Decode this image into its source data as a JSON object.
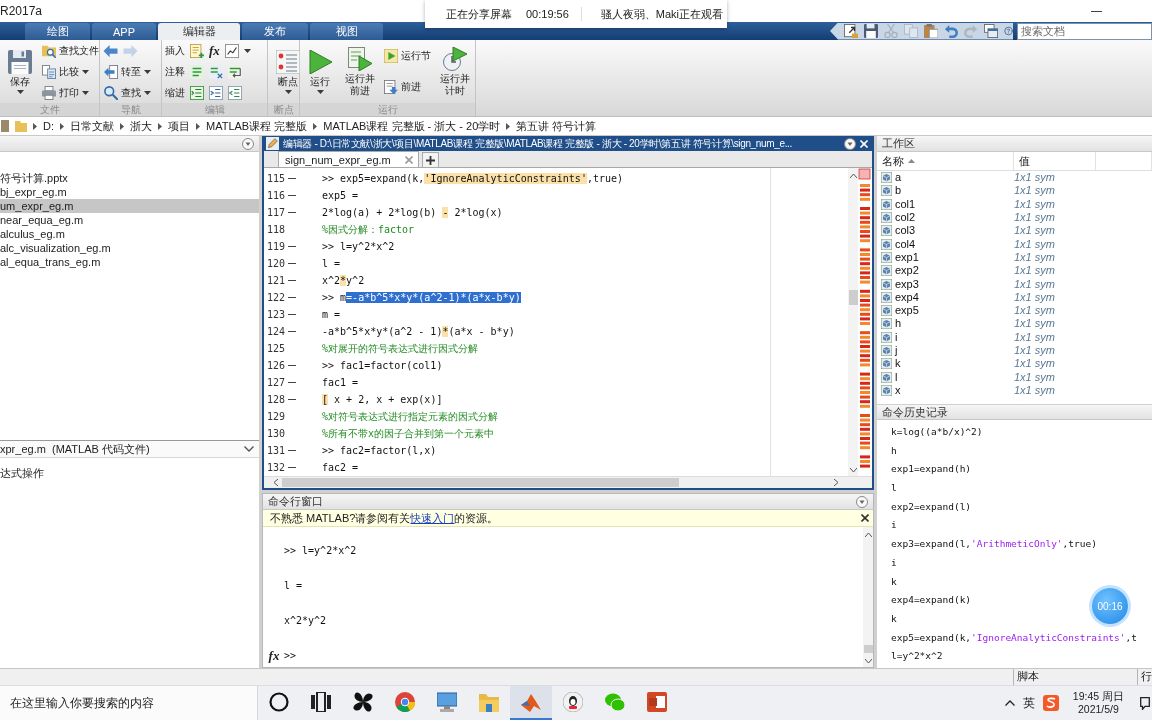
{
  "window": {
    "title": "R2017a"
  },
  "share_bar": {
    "status": "正在分享屏幕",
    "elapsed": "00:19:56",
    "viewers": "骚人夜弱、Maki正在观看"
  },
  "tabs": [
    {
      "label": "绘图",
      "selected": false
    },
    {
      "label": "APP",
      "selected": false
    },
    {
      "label": "编辑器",
      "selected": true
    },
    {
      "label": "发布",
      "selected": false
    },
    {
      "label": "视图",
      "selected": false
    }
  ],
  "quick_access": [
    {
      "disabled": false
    },
    {
      "disabled": false
    },
    {
      "disabled": true
    },
    {
      "disabled": true
    },
    {
      "disabled": false
    },
    {
      "disabled": false
    },
    {
      "disabled": true
    },
    {
      "disabled": false
    },
    {
      "disabled": false
    }
  ],
  "search": {
    "placeholder": "搜索文档"
  },
  "ribbon": [
    {
      "label": "文件",
      "columns": [
        [
          {
            "kind": "large",
            "label": "保存",
            "dropdown": true
          }
        ],
        [
          {
            "kind": "small",
            "label": "查找文件",
            "dropdown": false
          },
          {
            "kind": "small",
            "label": "比较",
            "dropdown": true
          },
          {
            "kind": "small",
            "label": "打印",
            "dropdown": true
          }
        ]
      ]
    },
    {
      "label": "导航",
      "columns": [
        [
          {
            "kind": "arrows",
            "forward_enabled": false
          },
          {
            "kind": "small",
            "label": "转至",
            "dropdown": true
          },
          {
            "kind": "small",
            "label": "查找",
            "dropdown": true
          }
        ]
      ]
    },
    {
      "label": "编辑",
      "columns": [
        [
          {
            "kind": "tools",
            "label": "插入",
            "symbol": "fx",
            "dropdown": true
          },
          {
            "kind": "tools",
            "label": "注释",
            "dropdown": false
          },
          {
            "kind": "tools",
            "label": "缩进",
            "dropdown": false
          }
        ]
      ]
    },
    {
      "label": "断点",
      "columns": [
        [
          {
            "kind": "large",
            "label": "断点",
            "dropdown": true
          }
        ]
      ]
    },
    {
      "label": "运行",
      "columns": [
        [
          {
            "kind": "large",
            "label": "运行",
            "dropdown": true
          }
        ],
        [
          {
            "kind": "large",
            "label": "运行并前进",
            "dropdown": false
          }
        ],
        [
          {
            "kind": "small",
            "label": "运行节",
            "dropdown": false
          },
          {
            "kind": "small",
            "label": "前进",
            "dropdown": false
          }
        ],
        [
          {
            "kind": "large",
            "label": "运行并计时",
            "dropdown": false
          }
        ]
      ]
    }
  ],
  "address_bar": {
    "segments": [
      "D:",
      "日常文献",
      "浙大",
      "项目",
      "MATLAB课程 完整版",
      "MATLAB课程 完整版 - 浙大 - 20学时",
      "第五讲 符号计算"
    ]
  },
  "current_folder": {
    "files": [
      {
        "name": "符号计算.pptx",
        "selected": false
      },
      {
        "name": "bj_expr_eg.m",
        "selected": false
      },
      {
        "name": "um_expr_eg.m",
        "selected": true
      },
      {
        "name": "near_equa_eg.m",
        "selected": false
      },
      {
        "name": "alculus_eg.m",
        "selected": false
      },
      {
        "name": "alc_visualization_eg.m",
        "selected": false
      },
      {
        "name": "al_equa_trans_eg.m",
        "selected": false
      }
    ],
    "details": {
      "title": "xpr_eg.m  (MATLAB 代码文件)",
      "description": "达式操作"
    }
  },
  "editor": {
    "title": "编辑器 - D:\\日常文献\\浙大\\项目\\MATLAB课程 完整版\\MATLAB课程 完整版 - 浙大 - 20学时\\第五讲 符号计算\\sign_num_e...",
    "tabs": [
      {
        "label": "sign_num_expr_eg.m",
        "selected": true
      }
    ],
    "lines": [
      {
        "number": "115",
        "executable": true,
        "parts": [
          {
            "kind": "code",
            "text": ">> exp5=expand(k,"
          },
          {
            "kind": "highlight",
            "text": "'IgnoreAnalyticConstraints'"
          },
          {
            "kind": "code",
            "text": ",true)"
          }
        ]
      },
      {
        "number": "116",
        "executable": true,
        "parts": [
          {
            "kind": "code",
            "text": "exp5 ="
          }
        ]
      },
      {
        "number": "117",
        "executable": true,
        "parts": [
          {
            "kind": "code",
            "text": "2*log(a) + 2*log(b) "
          },
          {
            "kind": "highlight",
            "text": "-"
          },
          {
            "kind": "code",
            "text": " 2*log(x)"
          }
        ]
      },
      {
        "number": "118",
        "executable": false,
        "parts": [
          {
            "kind": "comment",
            "text": "%因式分解：factor"
          }
        ]
      },
      {
        "number": "119",
        "executable": true,
        "parts": [
          {
            "kind": "code",
            "text": ">> l=y^2*x^2"
          }
        ]
      },
      {
        "number": "120",
        "executable": true,
        "parts": [
          {
            "kind": "code",
            "text": "l ="
          }
        ]
      },
      {
        "number": "121",
        "executable": true,
        "parts": [
          {
            "kind": "code",
            "text": "x^2"
          },
          {
            "kind": "highlight",
            "text": "*"
          },
          {
            "kind": "code",
            "text": "y^2"
          }
        ]
      },
      {
        "number": "122",
        "executable": true,
        "parts": [
          {
            "kind": "code",
            "text": ">> m"
          },
          {
            "kind": "selected",
            "text": "=-a*b^5*x*y*(a^2-1)*(a*x-b*y)"
          }
        ]
      },
      {
        "number": "123",
        "executable": true,
        "parts": [
          {
            "kind": "code",
            "text": "m ="
          }
        ]
      },
      {
        "number": "124",
        "executable": true,
        "parts": [
          {
            "kind": "code",
            "text": "-a*b^5*x*y*(a^2 - 1)"
          },
          {
            "kind": "highlight",
            "text": "*"
          },
          {
            "kind": "code",
            "text": "(a*x - b*y)"
          }
        ]
      },
      {
        "number": "125",
        "executable": false,
        "parts": [
          {
            "kind": "comment",
            "text": "%对展开的符号表达式进行因式分解"
          }
        ]
      },
      {
        "number": "126",
        "executable": true,
        "parts": [
          {
            "kind": "code",
            "text": ">> fac1=factor(col1)"
          }
        ]
      },
      {
        "number": "127",
        "executable": true,
        "parts": [
          {
            "kind": "code",
            "text": "fac1 ="
          }
        ]
      },
      {
        "number": "128",
        "executable": true,
        "parts": [
          {
            "kind": "highlight",
            "text": "["
          },
          {
            "kind": "code",
            "text": " x + 2, x + exp(x)]"
          }
        ]
      },
      {
        "number": "129",
        "executable": false,
        "parts": [
          {
            "kind": "comment",
            "text": "%对符号表达式进行指定元素的因式分解"
          }
        ]
      },
      {
        "number": "130",
        "executable": false,
        "parts": [
          {
            "kind": "comment",
            "text": "%所有不带x的因子合并到第一个元素中"
          }
        ]
      },
      {
        "number": "131",
        "executable": true,
        "parts": [
          {
            "kind": "code",
            "text": ">> fac2=factor(l,x)"
          }
        ]
      },
      {
        "number": "132",
        "executable": true,
        "parts": [
          {
            "kind": "code",
            "text": "fac2 ="
          }
        ]
      }
    ]
  },
  "command_window": {
    "title": "命令行窗口",
    "notice": {
      "before": "不熟悉 MATLAB?请参阅有关",
      "link": "快速入门",
      "after": "的资源。"
    },
    "lines": [
      ">> l=y^2*x^2",
      "l =",
      "x^2*y^2"
    ],
    "function_glyph": "fx",
    "prompt": ">>"
  },
  "workspace": {
    "title": "工作区",
    "columns": [
      {
        "label": "名称",
        "sorted": true
      },
      {
        "label": "值",
        "sorted": false
      }
    ],
    "variables": [
      {
        "name": "a",
        "value": "1x1 sym"
      },
      {
        "name": "b",
        "value": "1x1 sym"
      },
      {
        "name": "col1",
        "value": "1x1 sym"
      },
      {
        "name": "col2",
        "value": "1x1 sym"
      },
      {
        "name": "col3",
        "value": "1x1 sym"
      },
      {
        "name": "col4",
        "value": "1x1 sym"
      },
      {
        "name": "exp1",
        "value": "1x1 sym"
      },
      {
        "name": "exp2",
        "value": "1x1 sym"
      },
      {
        "name": "exp3",
        "value": "1x1 sym"
      },
      {
        "name": "exp4",
        "value": "1x1 sym"
      },
      {
        "name": "exp5",
        "value": "1x1 sym"
      },
      {
        "name": "h",
        "value": "1x1 sym"
      },
      {
        "name": "i",
        "value": "1x1 sym"
      },
      {
        "name": "j",
        "value": "1x1 sym"
      },
      {
        "name": "k",
        "value": "1x1 sym"
      },
      {
        "name": "l",
        "value": "1x1 sym"
      },
      {
        "name": "x",
        "value": "1x1 sym"
      }
    ]
  },
  "command_history": {
    "title": "命令历史记录",
    "entries": [
      [
        {
          "kind": "code",
          "text": "k=log((a*b/x)^2)"
        }
      ],
      [
        {
          "kind": "code",
          "text": "h"
        }
      ],
      [
        {
          "kind": "code",
          "text": "exp1=expand(h)"
        }
      ],
      [
        {
          "kind": "code",
          "text": "l"
        }
      ],
      [
        {
          "kind": "code",
          "text": "exp2=expand(l)"
        }
      ],
      [
        {
          "kind": "code",
          "text": "i"
        }
      ],
      [
        {
          "kind": "code",
          "text": "exp3=expand(l,"
        },
        {
          "kind": "string",
          "text": "'ArithmeticOnly'"
        },
        {
          "kind": "code",
          "text": ",true)"
        }
      ],
      [
        {
          "kind": "code",
          "text": "i"
        }
      ],
      [
        {
          "kind": "code",
          "text": "k"
        }
      ],
      [
        {
          "kind": "code",
          "text": "exp4=expand(k)"
        }
      ],
      [
        {
          "kind": "code",
          "text": "k"
        }
      ],
      [
        {
          "kind": "code",
          "text": "exp5=expand(k,"
        },
        {
          "kind": "string",
          "text": "'IgnoreAnalyticConstraints'"
        },
        {
          "kind": "code",
          "text": ",t"
        }
      ],
      [
        {
          "kind": "code",
          "text": "l=y^2*x^2"
        }
      ]
    ]
  },
  "status_bar": {
    "fields": [
      "脚本",
      "行"
    ]
  },
  "taskbar": {
    "search_placeholder": "在这里输入你要搜索的内容",
    "apps": [
      {
        "selected": false
      },
      {
        "selected": false
      },
      {
        "selected": false
      },
      {
        "selected": false
      },
      {
        "selected": false
      },
      {
        "selected": false
      },
      {
        "selected": true
      },
      {
        "selected": false
      },
      {
        "selected": false
      },
      {
        "selected": false
      }
    ],
    "tray": {
      "input_method": "英",
      "time": "19:45 周日",
      "date": "2021/5/9"
    }
  },
  "recording_badge": {
    "elapsed": "00:16"
  }
}
